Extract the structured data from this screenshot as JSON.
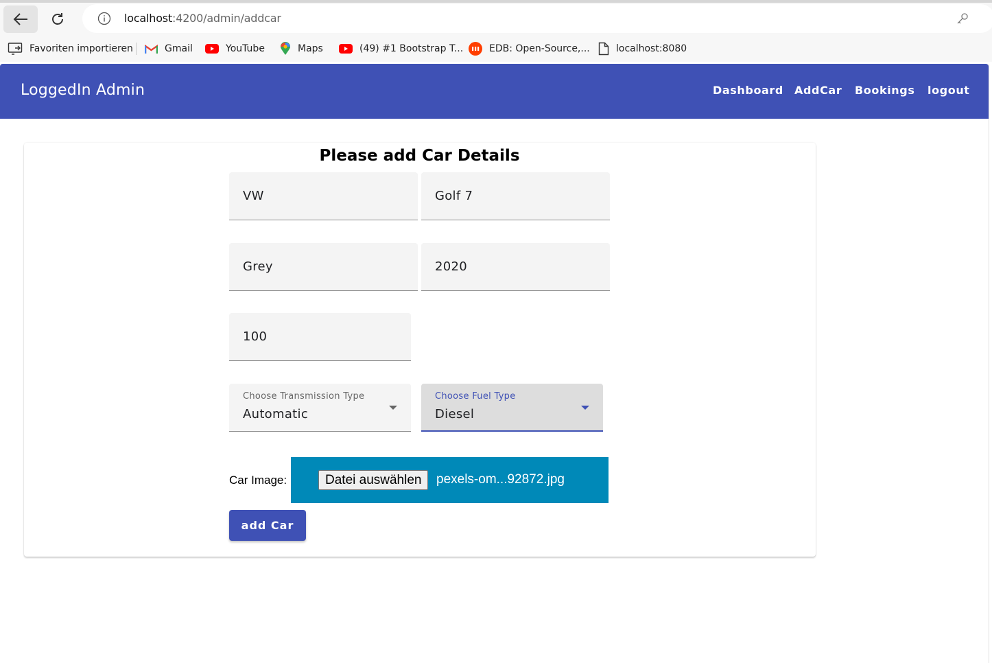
{
  "browser": {
    "url_host": "localhost",
    "url_path": ":4200/admin/addcar",
    "bookmarks": [
      {
        "label": "Favoriten importieren",
        "icon": "import-favorites-icon"
      },
      {
        "label": "Gmail",
        "icon": "gmail-icon"
      },
      {
        "label": "YouTube",
        "icon": "youtube-icon"
      },
      {
        "label": "Maps",
        "icon": "maps-icon"
      },
      {
        "label": "(49) #1 Bootstrap T...",
        "icon": "youtube-icon"
      },
      {
        "label": "EDB: Open-Source,...",
        "icon": "edb-icon"
      },
      {
        "label": "localhost:8080",
        "icon": "page-icon"
      }
    ]
  },
  "navbar": {
    "title": "LoggedIn Admin",
    "links": [
      "Dashboard",
      "AddCar",
      "Bookings",
      "logout"
    ],
    "color": "#3f51b5"
  },
  "form": {
    "title": "Please add Car Details",
    "brand": "VW",
    "name": "Golf 7",
    "color": "Grey",
    "year": "2020",
    "price": "100",
    "transmission": {
      "label": "Choose Transmission Type",
      "value": "Automatic"
    },
    "fuel": {
      "label": "Choose Fuel Type",
      "value": "Diesel"
    },
    "image_label": "Car Image:",
    "file_button": "Datei auswählen",
    "file_name": "pexels-om...92872.jpg",
    "submit": "add Car"
  }
}
